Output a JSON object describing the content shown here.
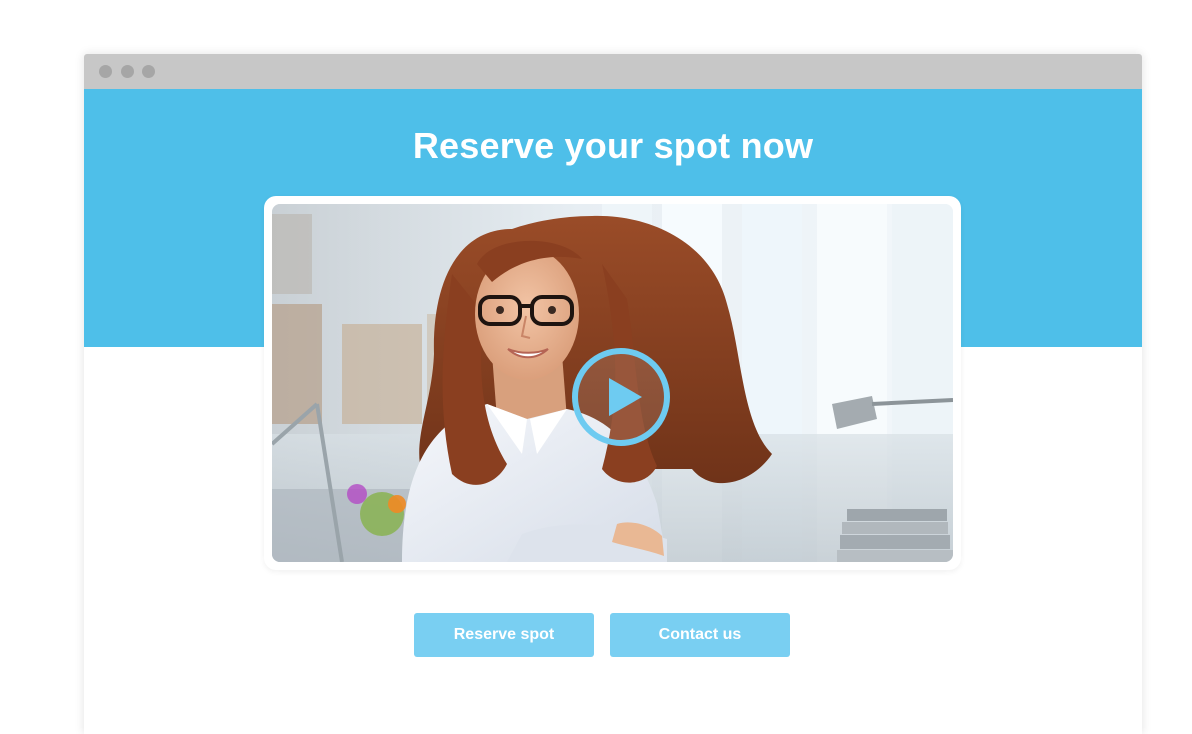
{
  "window": {
    "controls": [
      "close-dot",
      "minimize-dot",
      "maximize-dot"
    ]
  },
  "hero": {
    "headline": "Reserve your spot now",
    "background_color": "#4ebfe9"
  },
  "video": {
    "subject": "smiling woman with glasses in office",
    "play_icon": "play-icon",
    "play_icon_color": "#6ecbf1"
  },
  "actions": {
    "reserve_label": "Reserve spot",
    "contact_label": "Contact us",
    "button_color": "#79cff2"
  }
}
